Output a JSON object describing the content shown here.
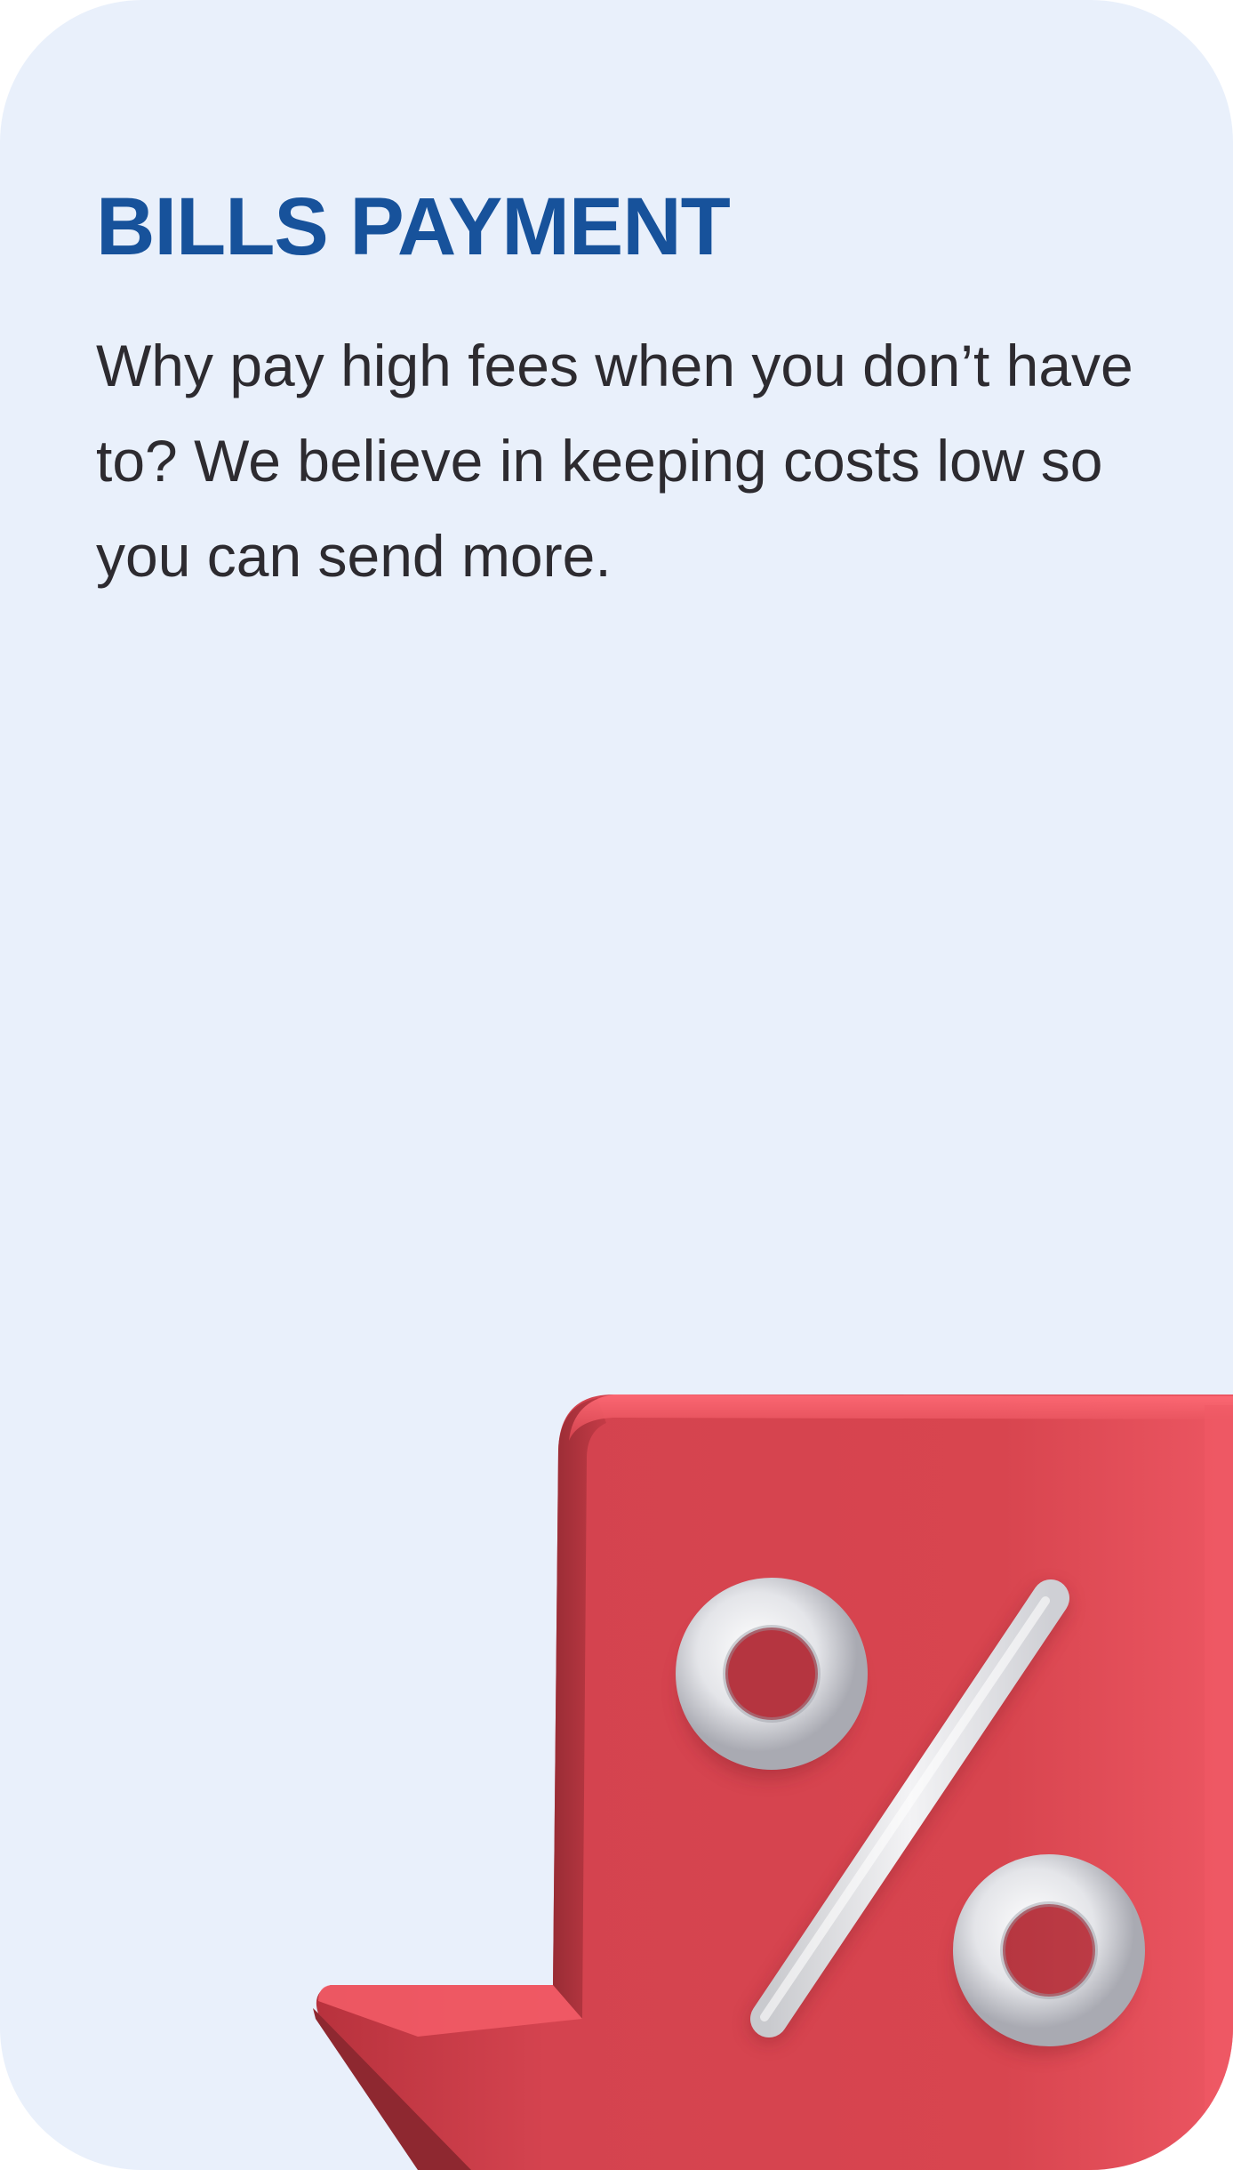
{
  "card": {
    "title": "BILLS PAYMENT",
    "description": "Why pay high fees when you don’t have to? We believe in keeping costs low so you can send more."
  },
  "illustration": {
    "icon": "percent-down-arrow-icon",
    "arrow_color": "#d8444f",
    "symbol_color": "#e6e7ea"
  },
  "colors": {
    "background": "#e9f0fb",
    "title": "#17529b",
    "body_text": "#2d2b30"
  }
}
